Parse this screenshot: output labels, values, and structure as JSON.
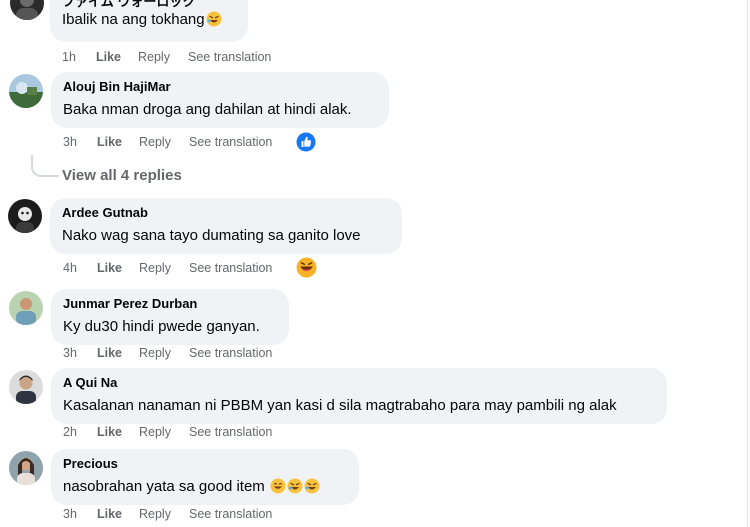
{
  "comments": [
    {
      "name": "ファイム ウォーロック",
      "text": "Ibalik na ang tokhang",
      "text_emoji": "rolling-laughing",
      "time": "1h",
      "like": "Like",
      "reply": "Reply",
      "translate": "See translation"
    },
    {
      "name": "Alouj Bin HajiMar",
      "text": "Baka nman droga ang dahilan at hindi alak.",
      "time": "3h",
      "like": "Like",
      "reply": "Reply",
      "translate": "See translation",
      "reaction": "like-reaction"
    },
    {
      "name": "Ardee Gutnab",
      "text": "Nako wag sana tayo dumating sa ganito love",
      "time": "4h",
      "like": "Like",
      "reply": "Reply",
      "translate": "See translation",
      "reaction": "haha-reaction"
    },
    {
      "name": "Junmar Perez Durban",
      "text": "Ky du30 hindi pwede ganyan.",
      "time": "3h",
      "like": "Like",
      "reply": "Reply",
      "translate": "See translation"
    },
    {
      "name": "A Qui Na",
      "text": "Kasalanan nanaman ni PBBM yan kasi d sila magtrabaho para may pambili ng alak",
      "time": "2h",
      "like": "Like",
      "reply": "Reply",
      "translate": "See translation"
    },
    {
      "name": "Precious",
      "text": "nasobrahan yata sa good item",
      "text_emoji": "smile-and-rolling-laughing",
      "time": "3h",
      "like": "Like",
      "reply": "Reply",
      "translate": "See translation"
    }
  ],
  "view_replies": "View all 4 replies",
  "colors": {
    "bubble": "#f0f2f5",
    "meta": "#65676b",
    "text": "#050505",
    "like_blue": "#1877f2"
  }
}
